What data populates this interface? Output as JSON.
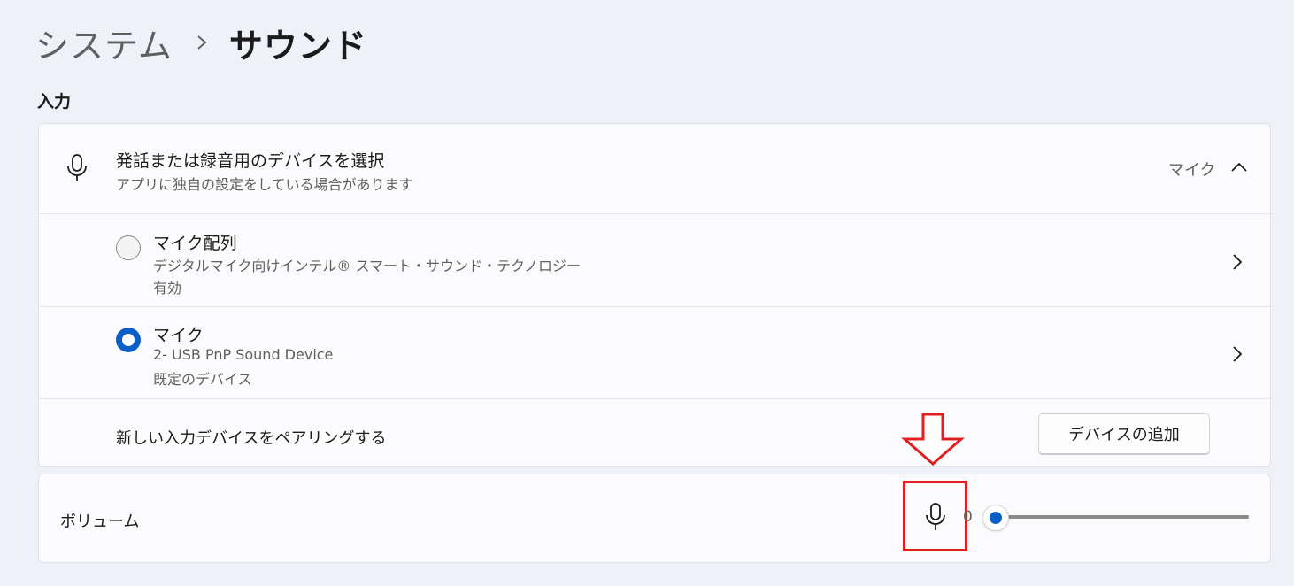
{
  "breadcrumb": {
    "parent": "システム",
    "current": "サウンド"
  },
  "input_section": {
    "label": "入力",
    "device_picker": {
      "title": "発話または録音用のデバイスを選択",
      "subtitle": "アプリに独自の設定をしている場合があります",
      "selected_value": "マイク",
      "expanded": true,
      "icon": "microphone-icon"
    },
    "devices": [
      {
        "name": "マイク配列",
        "description": "デジタルマイク向けインテル® スマート・サウンド・テクノロジー",
        "status": "有効",
        "selected": false
      },
      {
        "name": "マイク",
        "description": "2- USB PnP Sound Device",
        "status": "既定のデバイス",
        "selected": true
      }
    ],
    "pair": {
      "label": "新しい入力デバイスをペアリングする",
      "button_label": "デバイスの追加"
    }
  },
  "volume": {
    "label": "ボリューム",
    "value_text": "0",
    "value_percent": 0,
    "icon": "microphone-icon"
  },
  "annotations": {
    "arrow_icon": "down-arrow-icon",
    "highlight_color": "#e02020"
  },
  "colors": {
    "accent": "#0a5fc7",
    "background": "#eef2f8",
    "card": "#fbfbfd"
  }
}
